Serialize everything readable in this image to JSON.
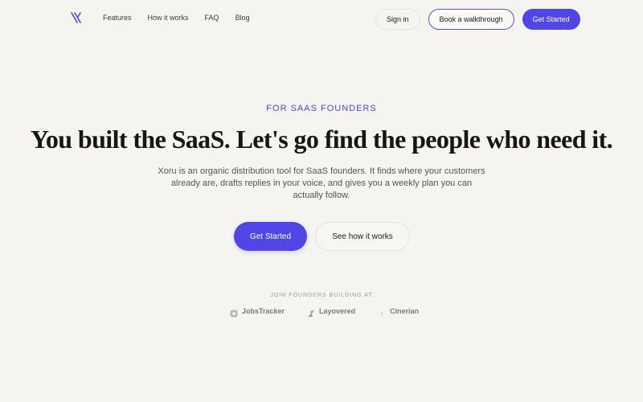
{
  "nav": {
    "logo_icon": "x-lambda-logo-icon",
    "links": [
      "Features",
      "How it works",
      "FAQ",
      "Blog"
    ],
    "sign_in": "Sign in",
    "walkthrough": "Book a walkthrough",
    "get_started": "Get Started"
  },
  "hero": {
    "eyebrow": "FOR SAAS FOUNDERS",
    "headline": "You built the SaaS. Let's go find the people who need it.",
    "subtitle": "Xoru is an organic distribution tool for SaaS founders. It finds where your customers already are, drafts replies in your voice, and gives you a weekly plan you can actually follow.",
    "primary_cta": "Get Started",
    "secondary_cta": "See how it works"
  },
  "social_proof": {
    "label": "JOIN FOUNDERS BUILDING AT",
    "brands": [
      {
        "name": "JobsTracker",
        "icon": "jobstracker-logo-icon"
      },
      {
        "name": "Layovered",
        "icon": "layovered-logo-icon"
      },
      {
        "name": "Cinerian",
        "icon": "cinerian-logo-icon"
      }
    ]
  },
  "colors": {
    "accent": "#4f46e5",
    "background": "#f5f4f0"
  }
}
